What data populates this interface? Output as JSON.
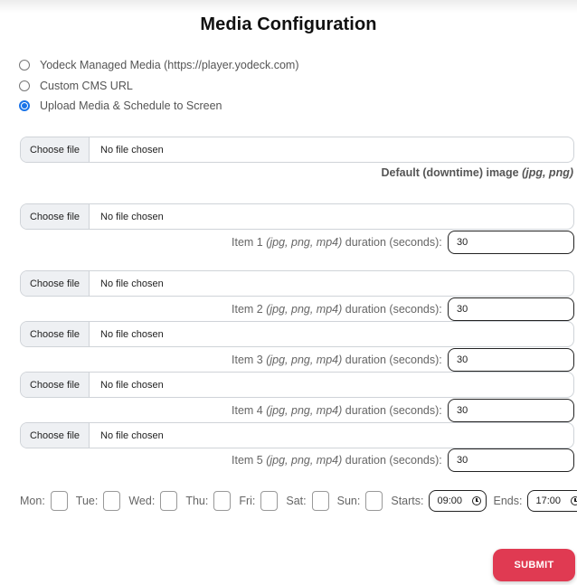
{
  "title": "Media Configuration",
  "source_options": [
    {
      "label": "Yodeck Managed Media (https://player.yodeck.com)",
      "checked": false
    },
    {
      "label": "Custom CMS URL",
      "checked": false
    },
    {
      "label": "Upload Media & Schedule to Screen",
      "checked": true
    }
  ],
  "file_input": {
    "button_label": "Choose file",
    "status": "No file chosen"
  },
  "default_image": {
    "label_prefix": "Default (downtime) image ",
    "label_types": "(jpg, png)"
  },
  "items": [
    {
      "prefix": "Item 1 ",
      "types": "(jpg, png, mp4)",
      "suffix": " duration (seconds):",
      "duration": "30"
    },
    {
      "prefix": "Item 2 ",
      "types": "(jpg, png, mp4)",
      "suffix": " duration (seconds):",
      "duration": "30"
    },
    {
      "prefix": "Item 3 ",
      "types": "(jpg, png, mp4)",
      "suffix": " duration (seconds):",
      "duration": "30"
    },
    {
      "prefix": "Item 4 ",
      "types": "(jpg, png, mp4)",
      "suffix": " duration (seconds):",
      "duration": "30"
    },
    {
      "prefix": "Item 5 ",
      "types": "(jpg, png, mp4)",
      "suffix": " duration (seconds):",
      "duration": "30"
    }
  ],
  "schedule": {
    "days": [
      "Mon:",
      "Tue:",
      "Wed:",
      "Thu:",
      "Fri:",
      "Sat:",
      "Sun:"
    ],
    "starts_label": "Starts:",
    "starts_value": "09:00",
    "ends_label": "Ends:",
    "ends_value": "17:00"
  },
  "submit_label": "SUBMIT",
  "colors": {
    "accent": "#1a73e8",
    "submit": "#e03a52"
  }
}
